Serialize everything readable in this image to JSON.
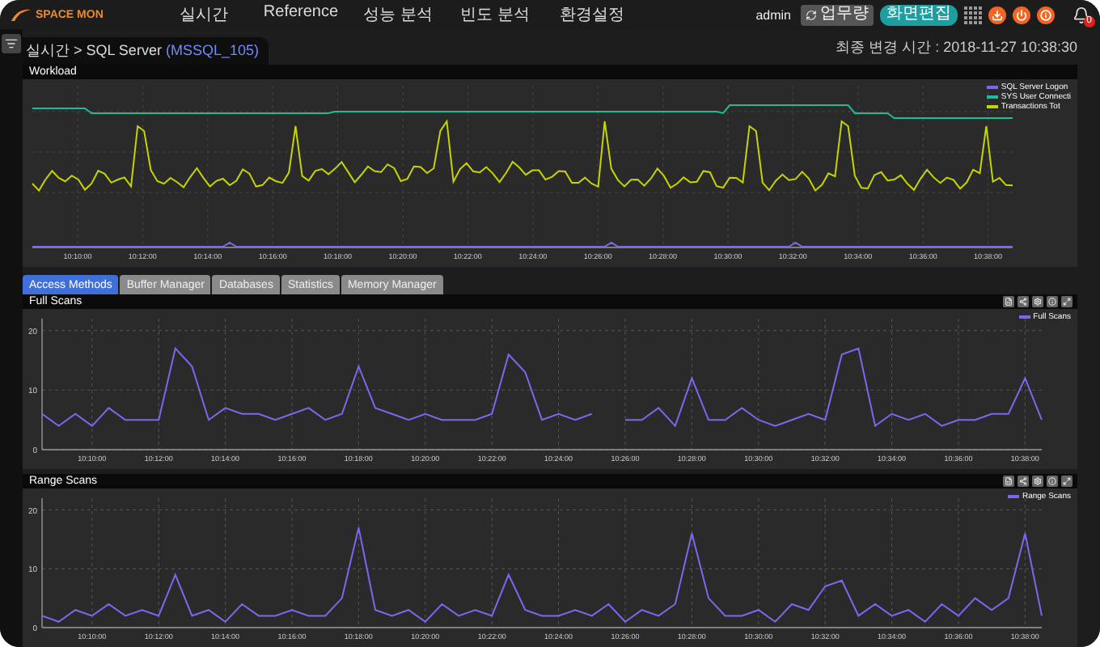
{
  "header": {
    "logo": "SPACE MON",
    "nav": [
      "실시간",
      "Reference",
      "성능 분석",
      "빈도 분석",
      "환경설정"
    ],
    "user": "admin",
    "workload_button": "업무량",
    "edit_button": "화면편집",
    "notification_count": "0"
  },
  "breadcrumb": {
    "path": "실시간 > SQL Server",
    "instance": "(MSSQL_105)"
  },
  "last_updated": "최종 변경 시간 : 2018-11-27 10:38:30",
  "workload": {
    "title": "Workload",
    "legend": [
      {
        "name": "SQL Server Logon",
        "color": "#7b68ee"
      },
      {
        "name": "SYS User Connecti",
        "color": "#1abc9c"
      },
      {
        "name": "Transactions Tot",
        "color": "#c8d400"
      }
    ],
    "xticks": [
      "10:10:00",
      "10:12:00",
      "10:14:00",
      "10:16:00",
      "10:18:00",
      "10:20:00",
      "10:22:00",
      "10:24:00",
      "10:26:00",
      "10:28:00",
      "10:30:00",
      "10:32:00",
      "10:34:00",
      "10:36:00",
      "10:38:00"
    ]
  },
  "tabs": [
    {
      "label": "Access Methods",
      "selected": true
    },
    {
      "label": "Buffer Manager",
      "selected": false
    },
    {
      "label": "Databases",
      "selected": false
    },
    {
      "label": "Statistics",
      "selected": false
    },
    {
      "label": "Memory Manager",
      "selected": false
    }
  ],
  "panels": [
    {
      "title": "Full Scans",
      "chart_data": {
        "type": "line",
        "grid": true,
        "ylim": [
          0,
          22
        ],
        "yticks": [
          0,
          10,
          20
        ],
        "categories": [
          null,
          null,
          null,
          "10:10:00",
          null,
          null,
          null,
          "10:12:00",
          null,
          null,
          null,
          "10:14:00",
          null,
          null,
          null,
          "10:16:00",
          null,
          null,
          null,
          "10:18:00",
          null,
          null,
          null,
          "10:20:00",
          null,
          null,
          null,
          "10:22:00",
          null,
          null,
          null,
          "10:24:00",
          null,
          null,
          null,
          "10:26:00",
          null,
          null,
          null,
          "10:28:00",
          null,
          null,
          null,
          "10:30:00",
          null,
          null,
          null,
          "10:32:00",
          null,
          null,
          null,
          "10:34:00",
          null,
          null,
          null,
          "10:36:00",
          null,
          null,
          null,
          "10:38:00",
          null
        ],
        "series": [
          {
            "name": "Full Scans",
            "color": "#7b68ee",
            "values": [
              6,
              4,
              6,
              4,
              7,
              5,
              5,
              5,
              17,
              14,
              5,
              7,
              6,
              6,
              5,
              6,
              7,
              5,
              6,
              14,
              7,
              6,
              5,
              6,
              5,
              5,
              5,
              6,
              16,
              13,
              5,
              6,
              5,
              6,
              null,
              5,
              5,
              7,
              4,
              12,
              5,
              5,
              7,
              5,
              4,
              5,
              6,
              5,
              16,
              17,
              4,
              6,
              5,
              6,
              4,
              5,
              5,
              6,
              6,
              12,
              5
            ]
          }
        ]
      }
    },
    {
      "title": "Range Scans",
      "chart_data": {
        "type": "line",
        "grid": true,
        "ylim": [
          0,
          22
        ],
        "yticks": [
          0,
          10,
          20
        ],
        "categories": [
          null,
          null,
          null,
          "10:10:00",
          null,
          null,
          null,
          "10:12:00",
          null,
          null,
          null,
          "10:14:00",
          null,
          null,
          null,
          "10:16:00",
          null,
          null,
          null,
          "10:18:00",
          null,
          null,
          null,
          "10:20:00",
          null,
          null,
          null,
          "10:22:00",
          null,
          null,
          null,
          "10:24:00",
          null,
          null,
          null,
          "10:26:00",
          null,
          null,
          null,
          "10:28:00",
          null,
          null,
          null,
          "10:30:00",
          null,
          null,
          null,
          "10:32:00",
          null,
          null,
          null,
          "10:34:00",
          null,
          null,
          null,
          "10:36:00",
          null,
          null,
          null,
          "10:38:00",
          null
        ],
        "series": [
          {
            "name": "Range Scans",
            "color": "#7b68ee",
            "values": [
              2,
              1,
              3,
              2,
              4,
              2,
              3,
              2,
              9,
              2,
              3,
              1,
              4,
              2,
              2,
              3,
              2,
              2,
              5,
              17,
              3,
              2,
              3,
              1,
              4,
              2,
              3,
              2,
              9,
              3,
              2,
              2,
              3,
              2,
              4,
              1,
              3,
              2,
              4,
              16,
              5,
              2,
              2,
              3,
              1,
              4,
              3,
              7,
              8,
              2,
              4,
              2,
              3,
              1,
              4,
              2,
              5,
              3,
              5,
              16,
              2
            ]
          }
        ]
      }
    }
  ]
}
